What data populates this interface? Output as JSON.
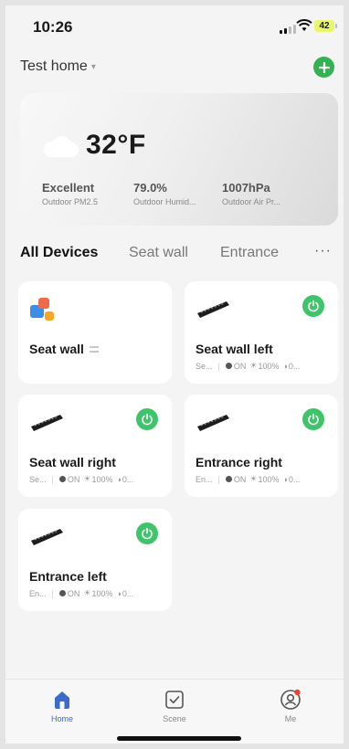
{
  "status_bar": {
    "time": "10:26",
    "battery": "42"
  },
  "header": {
    "home_name": "Test home",
    "caret": "▾"
  },
  "weather": {
    "temperature": "32°F",
    "stats": [
      {
        "value": "Excellent",
        "label": "Outdoor PM2.5"
      },
      {
        "value": "79.0%",
        "label": "Outdoor Humid..."
      },
      {
        "value": "1007hPa",
        "label": "Outdoor Air Pr..."
      }
    ]
  },
  "tabs": {
    "all": "All Devices",
    "seat_wall": "Seat wall",
    "entrance": "Entrance",
    "more": "···"
  },
  "devices": [
    {
      "name": "Seat wall",
      "type": "group"
    },
    {
      "name": "Seat wall left",
      "room": "Se...",
      "status": "ON",
      "brightness": "100%",
      "extra": "0..."
    },
    {
      "name": "Seat wall right",
      "room": "Se...",
      "status": "ON",
      "brightness": "100%",
      "extra": "0..."
    },
    {
      "name": "Entrance right",
      "room": "En...",
      "status": "ON",
      "brightness": "100%",
      "extra": "0..."
    },
    {
      "name": "Entrance left",
      "room": "En...",
      "status": "ON",
      "brightness": "100%",
      "extra": "0..."
    }
  ],
  "nav": {
    "home": "Home",
    "scene": "Scene",
    "me": "Me"
  },
  "colors": {
    "accent_green": "#3fc46c",
    "add_green": "#32b253",
    "nav_active": "#3b6ccb",
    "notification": "#e8443a"
  },
  "icons": {
    "power": "power-icon",
    "add": "plus-icon",
    "light_bar": "light-bar-icon",
    "group": "device-group-icon"
  }
}
